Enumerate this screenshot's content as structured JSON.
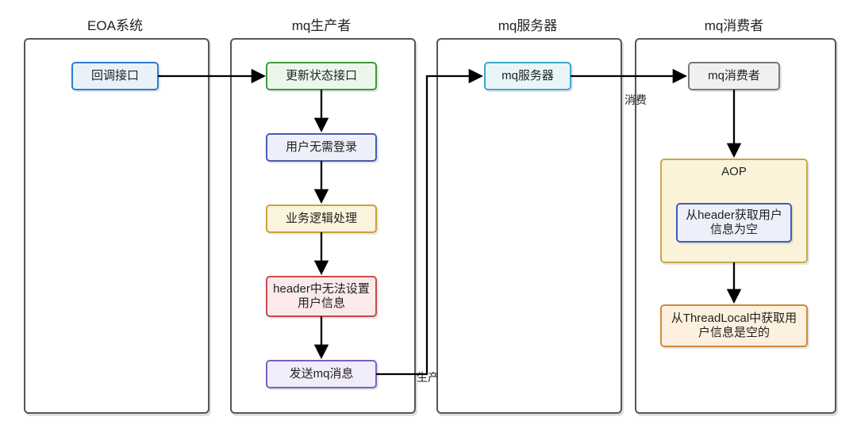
{
  "lanes": {
    "eoa": {
      "title": "EOA系统"
    },
    "producer": {
      "title": "mq生产者"
    },
    "server": {
      "title": "mq服务器"
    },
    "consumer": {
      "title": "mq消费者"
    }
  },
  "nodes": {
    "callback": "回调接口",
    "updateState": "更新状态接口",
    "noLogin": "用户无需登录",
    "bizLogic": "业务逻辑处理",
    "headerNoSet": "header中无法设置用户信息",
    "sendMq": "发送mq消息",
    "mqServer": "mq服务器",
    "mqConsumer": "mq消费者",
    "aop": "AOP",
    "headerEmpty": "从header获取用户信息为空",
    "threadLocalEmpty": "从ThreadLocal中获取用户信息是空的"
  },
  "edgeLabels": {
    "produce": "生产",
    "consume": "消费"
  }
}
